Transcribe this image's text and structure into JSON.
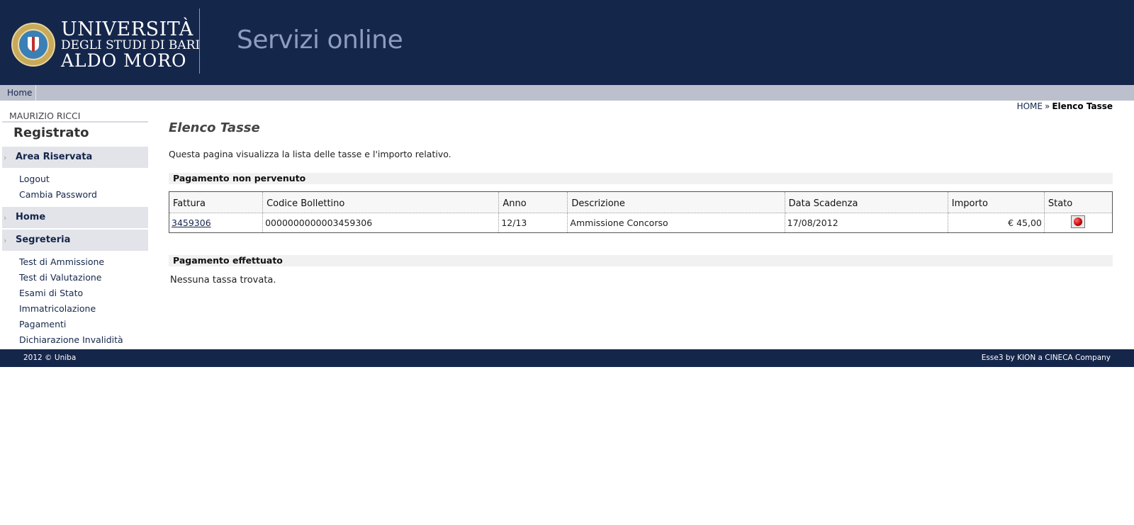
{
  "header": {
    "logo_line1": "UNIVERSITÀ",
    "logo_line2": "DEGLI STUDI DI BARI",
    "logo_line3": "ALDO MORO",
    "app_title": "Servizi online"
  },
  "navbar": {
    "home_label": "Home"
  },
  "breadcrumb": {
    "home": "HOME",
    "separator": "»",
    "current": "Elenco Tasse"
  },
  "sidebar": {
    "user_name": "MAURIZIO RICCI",
    "user_status": "Registrato",
    "area_riservata": {
      "label": "Area Riservata",
      "items": [
        {
          "label": "Logout"
        },
        {
          "label": "Cambia Password"
        }
      ]
    },
    "home": {
      "label": "Home"
    },
    "segreteria": {
      "label": "Segreteria",
      "items": [
        {
          "label": "Test di Ammissione"
        },
        {
          "label": "Test di Valutazione"
        },
        {
          "label": "Esami di Stato"
        },
        {
          "label": "Immatricolazione"
        },
        {
          "label": "Pagamenti"
        },
        {
          "label": "Dichiarazione Invalidità"
        }
      ]
    }
  },
  "main": {
    "title": "Elenco Tasse",
    "intro": "Questa pagina visualizza la lista delle tasse e l'importo relativo.",
    "pending_section": "Pagamento non pervenuto",
    "table": {
      "headers": [
        "Fattura",
        "Codice Bollettino",
        "Anno",
        "Descrizione",
        "Data Scadenza",
        "Importo",
        "Stato"
      ],
      "rows": [
        {
          "fattura": "3459306",
          "codice": "0000000000003459306",
          "anno": "12/13",
          "descrizione": "Ammissione Concorso",
          "scadenza": "17/08/2012",
          "importo": "€ 45,00",
          "stato_icon": "red-semaphore-icon"
        }
      ]
    },
    "paid_section": "Pagamento effettuato",
    "paid_empty": "Nessuna tassa trovata."
  },
  "footer": {
    "left": "2012 © Uniba",
    "right": "Esse3 by KION a CINECA Company"
  },
  "colors": {
    "header_bg": "#15264b",
    "navbar_bg": "#bcc0cc",
    "accent_link": "#15264b",
    "status_red": "#c00000"
  }
}
